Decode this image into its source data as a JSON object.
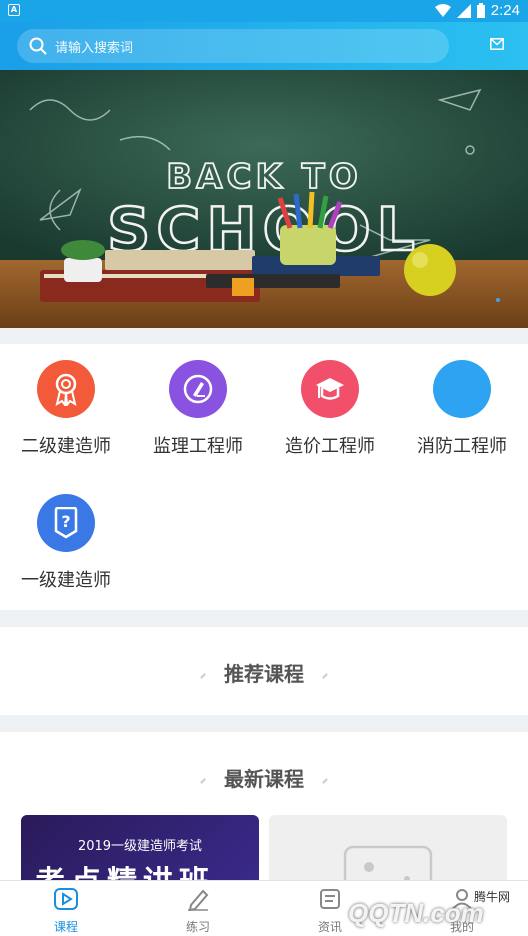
{
  "status": {
    "time": "2:24",
    "left_badge": "A"
  },
  "search": {
    "placeholder": "请输入搜索词"
  },
  "banner": {
    "text_line1": "BACK TO",
    "text_line2": "SCHOOL"
  },
  "categories": [
    {
      "label": "二级建造师",
      "color": "#f25a3a",
      "icon": "award-ribbon-icon"
    },
    {
      "label": "监理工程师",
      "color": "#8a52e0",
      "icon": "pencil-edit-icon"
    },
    {
      "label": "造价工程师",
      "color": "#f2506a",
      "icon": "graduation-cap-icon"
    },
    {
      "label": "消防工程师",
      "color": "#2ea3f2",
      "icon": "blank-circle-icon"
    },
    {
      "label": "一级建造师",
      "color": "#3a78e6",
      "icon": "question-doc-icon"
    }
  ],
  "sections": {
    "recommended": "推荐课程",
    "latest": "最新课程"
  },
  "course_card": {
    "tagline": "2019一级建造师考试",
    "big_text": "考点精讲班"
  },
  "tabs": [
    {
      "label": "课程",
      "active": true
    },
    {
      "label": "练习",
      "active": false
    },
    {
      "label": "资讯",
      "active": false
    },
    {
      "label": "我的",
      "active": false
    }
  ],
  "watermark": {
    "site": "腾牛网",
    "logo": "QQTN.com"
  },
  "colors": {
    "accent": "#1aa5e8",
    "active_tab": "#1a8fe0"
  }
}
